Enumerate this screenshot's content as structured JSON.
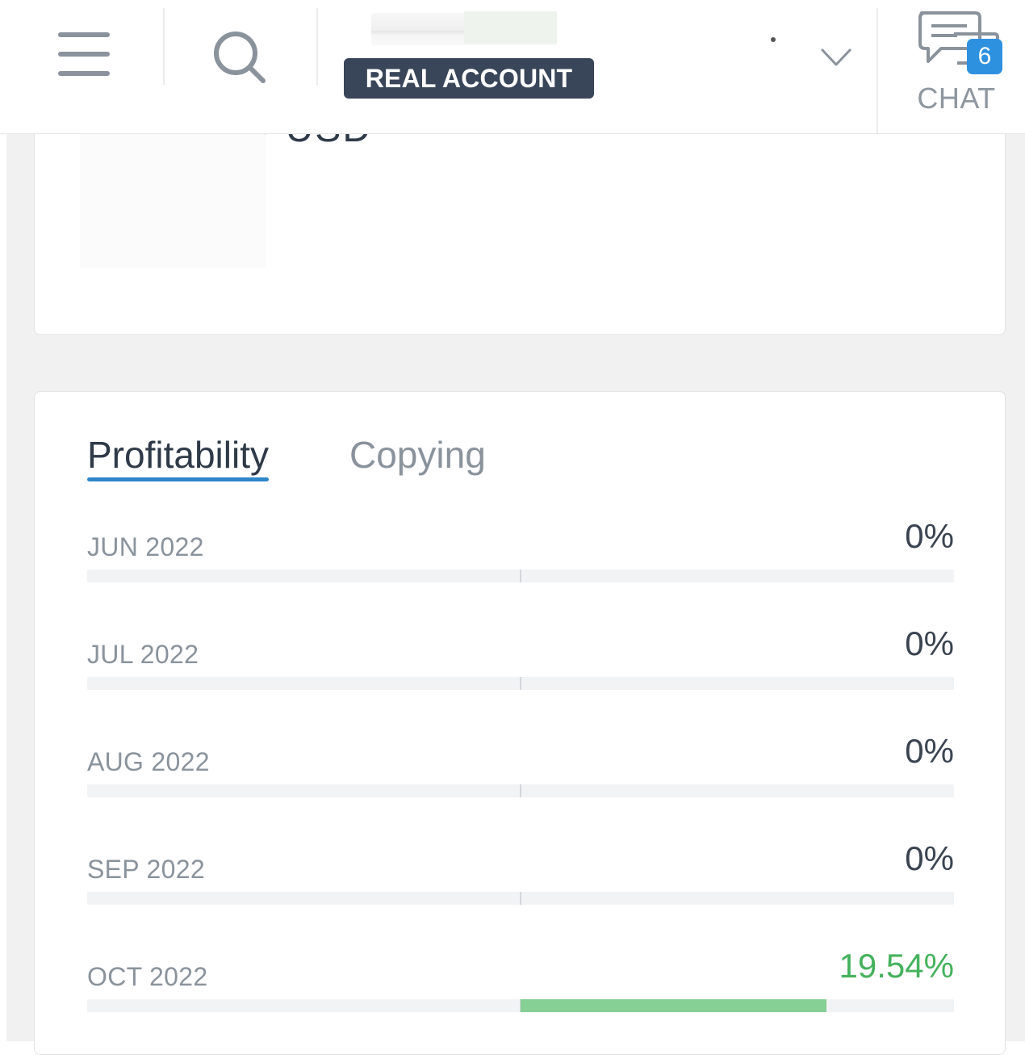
{
  "header": {
    "account_badge": "REAL ACCOUNT",
    "chat_label": "CHAT",
    "chat_badge_count": "6",
    "icons": [
      "menu-icon",
      "search-icon",
      "chevron-down-icon",
      "chat-icon"
    ]
  },
  "top_card": {
    "balance_partial": "/ USD"
  },
  "profit_card": {
    "tabs": [
      {
        "label": "Profitability",
        "active": true
      },
      {
        "label": "Copying",
        "active": false
      }
    ],
    "months": [
      {
        "label": "JUN 2022",
        "value_text": "0%",
        "value": 0
      },
      {
        "label": "JUL 2022",
        "value_text": "0%",
        "value": 0
      },
      {
        "label": "AUG 2022",
        "value_text": "0%",
        "value": 0
      },
      {
        "label": "SEP 2022",
        "value_text": "0%",
        "value": 0
      },
      {
        "label": "OCT 2022",
        "value_text": "19.54%",
        "value": 19.54
      }
    ]
  },
  "colors": {
    "badge_bg": "#394659",
    "accent_blue": "#2e86c9",
    "chat_badge": "#2e91e0",
    "positive_green": "#45b25d",
    "positive_bar": "#86cf95"
  }
}
